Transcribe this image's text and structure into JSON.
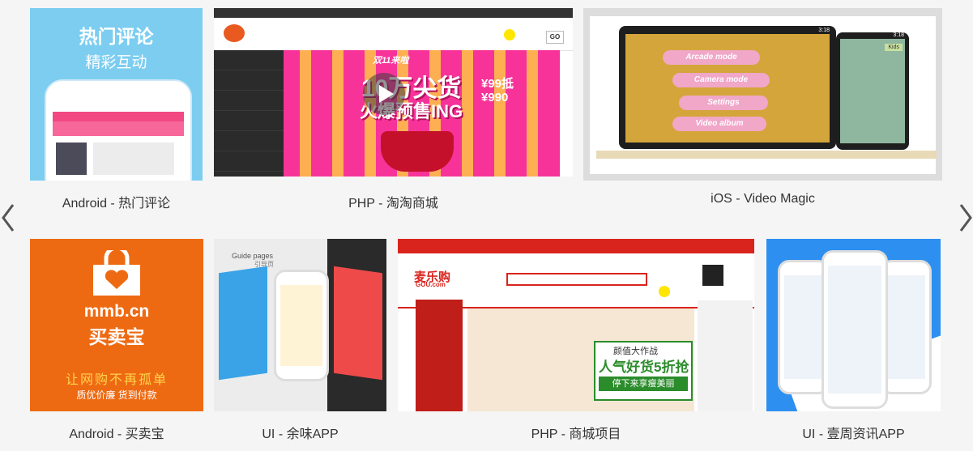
{
  "portfolio": {
    "items": [
      {
        "caption": "Android - 热门评论",
        "headline": "热门评论",
        "subline": "精彩互动"
      },
      {
        "caption": "PHP - 淘淘商城",
        "banner_main": "10万尖货",
        "banner_sub": "火爆预售ING",
        "price_a": "¥99抵",
        "price_b": "¥990",
        "event": "双11来啦",
        "go": "GO"
      },
      {
        "caption": "iOS - Video Magic",
        "menu": [
          "Arcade mode",
          "Camera mode",
          "Settings",
          "Video album"
        ],
        "side_label": "Kids",
        "clock": "3:18"
      },
      {
        "caption": "Android - 买卖宝",
        "brand": "mmb.cn",
        "brand_cn": "买卖宝",
        "slogan": "让网购不再孤单",
        "tagline": "质优价廉 货到付款"
      },
      {
        "caption": "UI - 余味APP",
        "guide_title": "Guide pages",
        "guide_sub": "引导页"
      },
      {
        "caption": "PHP - 商城项目",
        "shop_name": "麦乐购",
        "shop_domain": "GOU.com",
        "promo_top": "颜值大作战",
        "promo_main": "人气好货5折抢",
        "promo_sub": "停下来享瘦美丽"
      },
      {
        "caption": "UI - 壹周资讯APP"
      }
    ]
  },
  "colors": {
    "android_blue": "#7ccdf0",
    "mmb_orange": "#ee6a12",
    "news_blue": "#2d8ff0",
    "shop_red": "#d9231d",
    "banner_pink": "#f7339a"
  },
  "icons": {
    "prev": "chevron-left-icon",
    "next": "chevron-right-icon"
  }
}
